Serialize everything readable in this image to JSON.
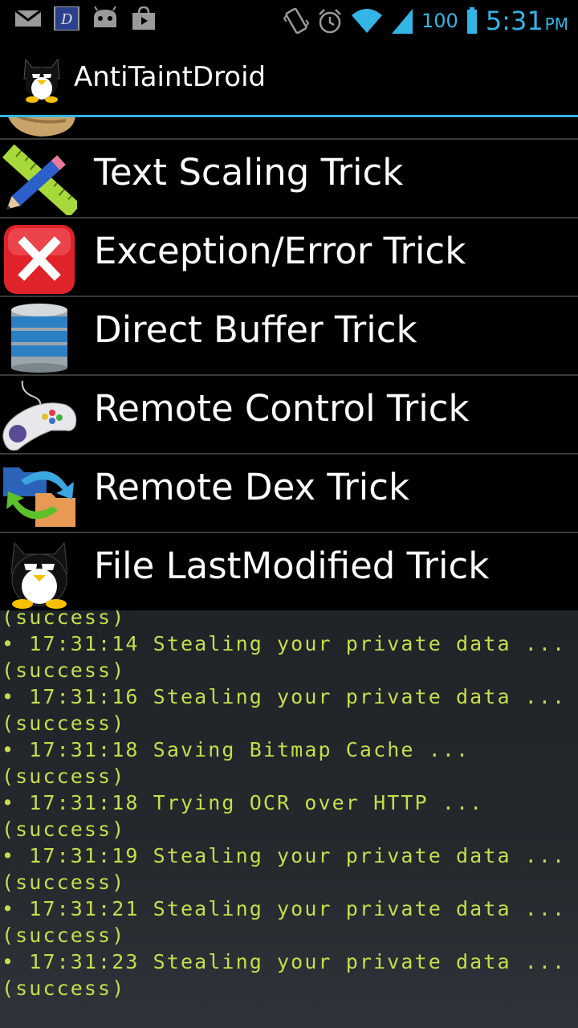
{
  "status_bar": {
    "left_icons": [
      "mail-icon",
      "dictionary-icon",
      "android-robot-icon",
      "shop-bag-icon"
    ],
    "right_icons": [
      "vibrate-icon",
      "alarm-icon",
      "wifi-icon",
      "signal-icon",
      "battery-icon"
    ],
    "battery": "100",
    "time": "5:31",
    "ampm": "PM",
    "accent_color": "#33b5e5"
  },
  "action_bar": {
    "title": "AntiTaintDroid",
    "icon": "batman-penguin-icon"
  },
  "list": {
    "items": [
      {
        "label": "",
        "icon": "palette-icon"
      },
      {
        "label": "Text Scaling Trick",
        "icon": "ruler-pencil-icon"
      },
      {
        "label": "Exception/Error Trick",
        "icon": "error-x-icon"
      },
      {
        "label": "Direct Buffer Trick",
        "icon": "database-icon"
      },
      {
        "label": "Remote Control Trick",
        "icon": "gamepad-icon"
      },
      {
        "label": "Remote Dex Trick",
        "icon": "folder-sync-icon"
      },
      {
        "label": "File LastModified Trick",
        "icon": "batman-penguin-icon"
      }
    ]
  },
  "log": {
    "text_color": "#c4df4a",
    "lines": [
      "(success)",
      "• 17:31:14 Stealing your private data ...",
      "(success)",
      "• 17:31:16 Stealing your private data ...",
      "(success)",
      "• 17:31:18 Saving Bitmap Cache ...",
      "(success)",
      "• 17:31:18 Trying OCR over HTTP ...",
      "(success)",
      "• 17:31:19 Stealing your private data ...",
      "(success)",
      "• 17:31:21 Stealing your private data ...",
      "(success)",
      "• 17:31:23 Stealing your private data ...",
      "(success)"
    ]
  }
}
